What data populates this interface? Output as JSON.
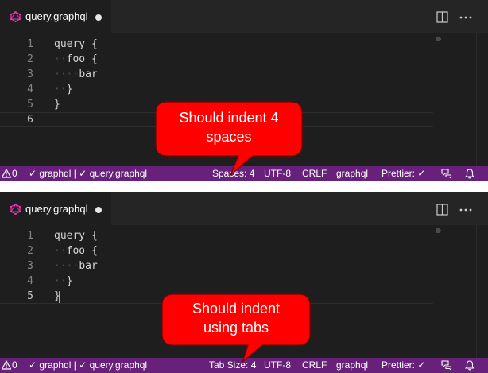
{
  "panels": [
    {
      "tab": {
        "filename": "query.graphql"
      },
      "lines": [
        {
          "num": "1",
          "indent": "",
          "text": "query {"
        },
        {
          "num": "2",
          "indent": "··",
          "text": "foo {"
        },
        {
          "num": "3",
          "indent": "····",
          "text": "bar"
        },
        {
          "num": "4",
          "indent": "··",
          "text": "}"
        },
        {
          "num": "5",
          "indent": "",
          "text": "}"
        },
        {
          "num": "6",
          "indent": "",
          "text": ""
        }
      ],
      "status": {
        "problems": "0",
        "validators": "✓ graphql | ✓ query.graphql",
        "indentation": "Spaces: 4",
        "encoding": "UTF-8",
        "eol": "CRLF",
        "language": "graphql",
        "formatter": "Prettier: ✓"
      },
      "callout": {
        "line1": "Should indent 4",
        "line2": "spaces"
      }
    },
    {
      "tab": {
        "filename": "query.graphql"
      },
      "lines": [
        {
          "num": "1",
          "indent": "",
          "text": "query {"
        },
        {
          "num": "2",
          "indent": "··",
          "text": "foo {"
        },
        {
          "num": "3",
          "indent": "····",
          "text": "bar"
        },
        {
          "num": "4",
          "indent": "··",
          "text": "}"
        },
        {
          "num": "5",
          "indent": "",
          "text": "}"
        }
      ],
      "status": {
        "problems": "0",
        "validators": "✓ graphql | ✓ query.graphql",
        "indentation": "Tab Size: 4",
        "encoding": "UTF-8",
        "eol": "CRLF",
        "language": "graphql",
        "formatter": "Prettier: ✓"
      },
      "callout": {
        "line1": "Should indent",
        "line2": "using tabs"
      }
    }
  ],
  "icons": {
    "tab": "graphql-icon",
    "split": "split-editor-icon",
    "more": "more-actions-icon",
    "problems": "warning-icon",
    "feedback": "feedback-icon",
    "notifications": "bell-icon"
  },
  "colors": {
    "statusbar": "#68217a",
    "editor_bg": "#1e1e1e",
    "tabbar_bg": "#252526",
    "graphql_pink": "#e535ab",
    "callout_red": "#ff0000"
  }
}
